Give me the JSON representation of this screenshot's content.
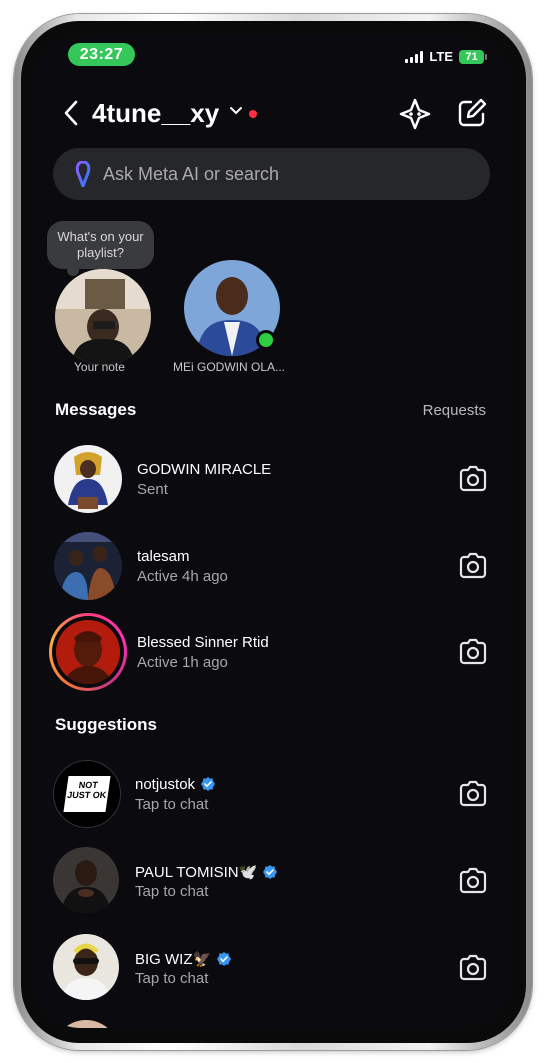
{
  "status": {
    "time": "23:27",
    "network": "LTE",
    "battery": "71"
  },
  "header": {
    "username": "4tune__xy"
  },
  "search": {
    "placeholder": "Ask Meta AI or search"
  },
  "notes": {
    "bubble": "What's on your playlist?",
    "items": [
      {
        "label": "Your note"
      },
      {
        "label": "MEi GODWIN OLA..."
      }
    ]
  },
  "messages": {
    "title": "Messages",
    "requests_label": "Requests",
    "items": [
      {
        "name": "GODWIN MIRACLE",
        "status": "Sent"
      },
      {
        "name": "talesam",
        "status": "Active 4h ago"
      },
      {
        "name": "Blessed Sinner Rtid",
        "status": "Active 1h ago"
      }
    ]
  },
  "suggestions": {
    "title": "Suggestions",
    "items": [
      {
        "name": "notjustok",
        "status": "Tap to chat",
        "logo_text": "NOT JUST OK"
      },
      {
        "name": "PAUL TOMISIN🕊️",
        "status": "Tap to chat"
      },
      {
        "name": "BIG WIZ🦅",
        "status": "Tap to chat"
      }
    ]
  },
  "colors": {
    "accent_verified": "#3897f0",
    "online": "#2ecc40",
    "time_pill": "#35c759",
    "notification_dot": "#ff3040"
  }
}
